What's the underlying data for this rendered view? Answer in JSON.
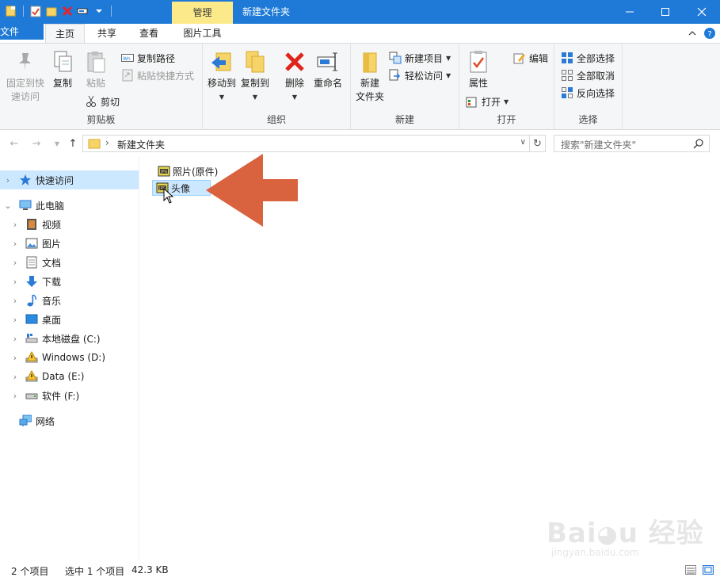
{
  "titlebar": {
    "context_tab": "管理",
    "title": "新建文件夹",
    "bg_color": "#1e7ad6",
    "context_color": "#fbe98a"
  },
  "tabs": {
    "file": "文件",
    "home": "主页",
    "share": "共享",
    "view": "查看",
    "picture_tools": "图片工具"
  },
  "ribbon": {
    "clipboard": {
      "pin": "固定到快速访问",
      "pin_line1": "固定到快",
      "pin_line2": "速访问",
      "copy": "复制",
      "paste": "粘贴",
      "copy_path": "复制路径",
      "paste_shortcut": "粘贴快捷方式",
      "cut": "剪切",
      "label": "剪贴板"
    },
    "organize": {
      "move_to": "移动到",
      "copy_to": "复制到",
      "delete": "删除",
      "rename": "重命名",
      "label": "组织"
    },
    "new": {
      "new_folder_line1": "新建",
      "new_folder_line2": "文件夹",
      "new_item": "新建项目",
      "easy_access": "轻松访问",
      "label": "新建"
    },
    "open": {
      "properties": "属性",
      "open": "打开",
      "edit": "编辑",
      "label": "打开"
    },
    "select": {
      "select_all": "全部选择",
      "select_none": "全部取消",
      "invert": "反向选择",
      "label": "选择"
    }
  },
  "address": {
    "path": "新建文件夹",
    "search_placeholder": "搜索\"新建文件夹\""
  },
  "nav": {
    "quick_access": "快速访问",
    "this_pc": "此电脑",
    "videos": "视频",
    "pictures": "图片",
    "documents": "文档",
    "downloads": "下载",
    "music": "音乐",
    "desktop": "桌面",
    "drive_c": "本地磁盘 (C:)",
    "drive_d": "Windows (D:)",
    "drive_e": "Data (E:)",
    "drive_f": "软件 (F:)",
    "network": "网络"
  },
  "files": [
    {
      "name": "照片(原件)",
      "selected": false
    },
    {
      "name": "头像",
      "selected": true
    }
  ],
  "status": {
    "count": "2 个项目",
    "selection": "选中 1 个项目",
    "size": "42.3 KB"
  },
  "colors": {
    "selection": "#cce8ff",
    "annotation_arrow": "#d9623f"
  }
}
